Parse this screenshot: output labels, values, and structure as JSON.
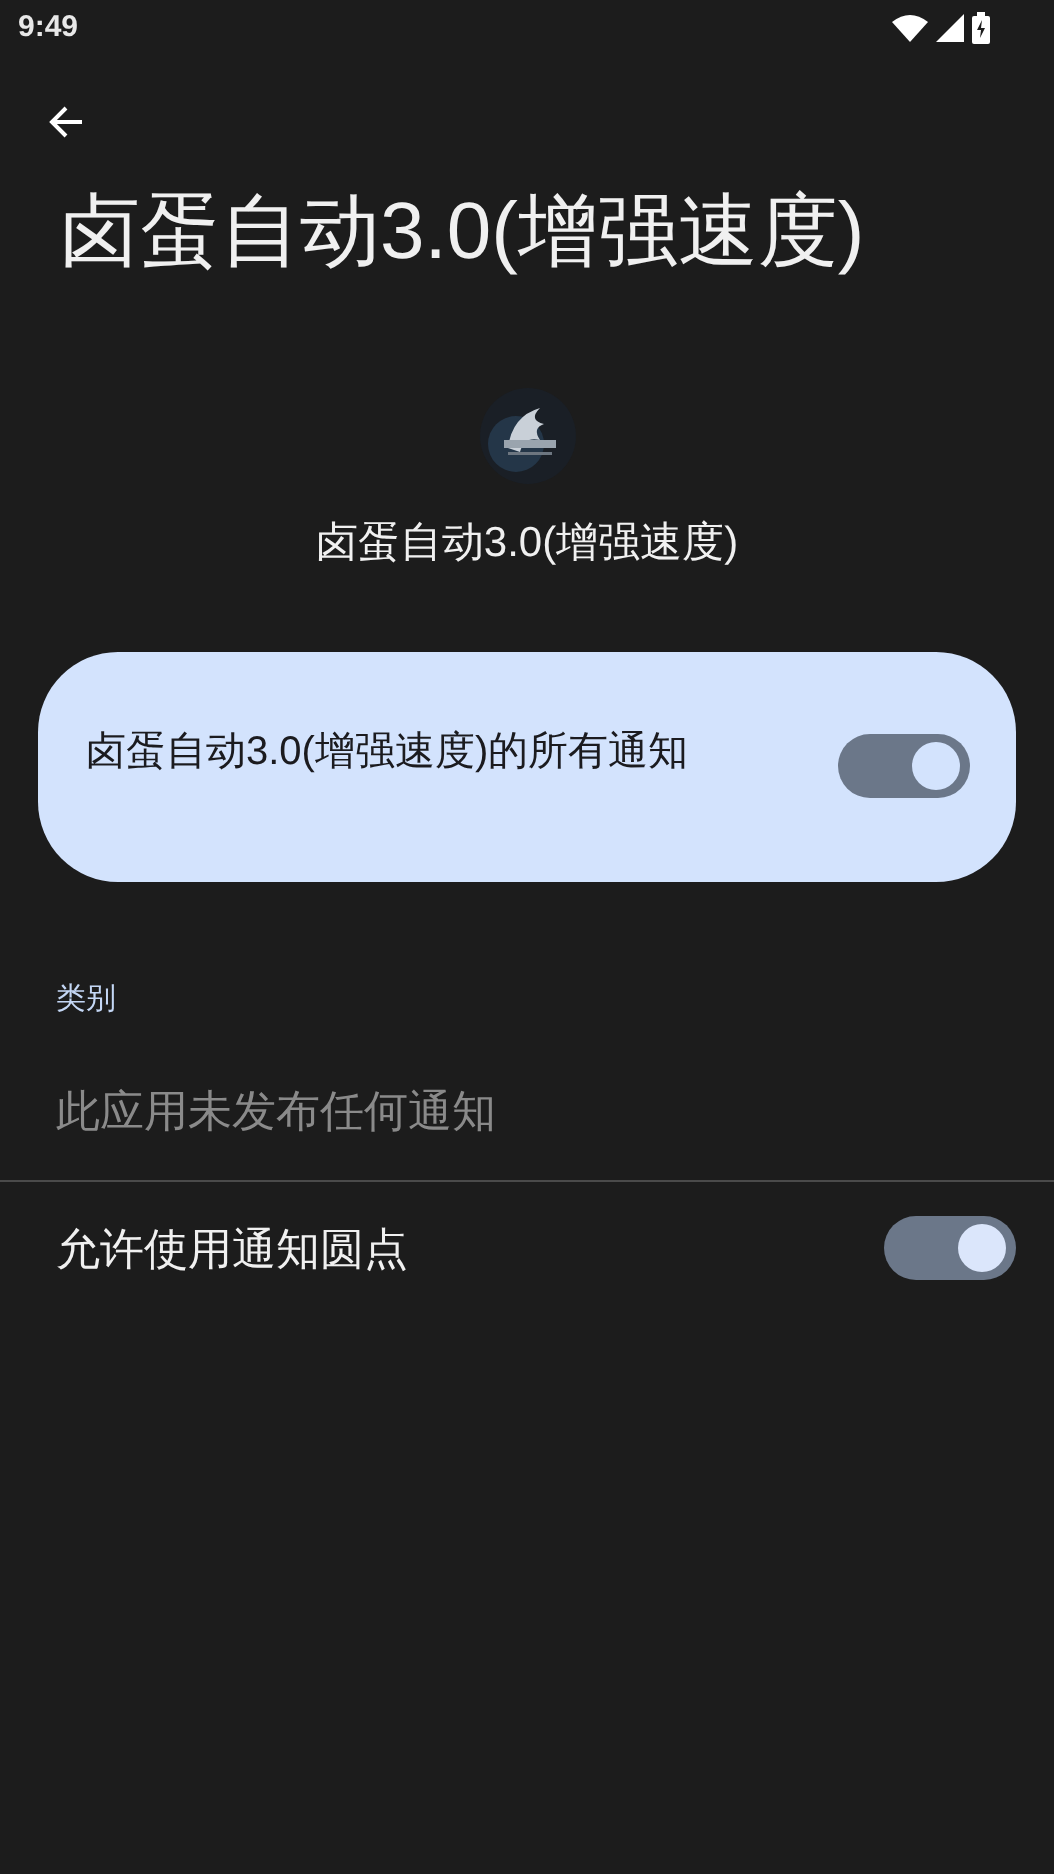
{
  "status_bar": {
    "time": "9:49"
  },
  "header": {
    "title": "卤蛋自动3.0(增强速度)"
  },
  "app": {
    "name": "卤蛋自动3.0(增强速度)"
  },
  "main_toggle": {
    "label": "卤蛋自动3.0(增强速度)的所有通知",
    "on": true
  },
  "categories": {
    "heading": "类别",
    "empty_text": "此应用未发布任何通知"
  },
  "settings": [
    {
      "label": "允许使用通知圆点",
      "on": true
    }
  ]
}
